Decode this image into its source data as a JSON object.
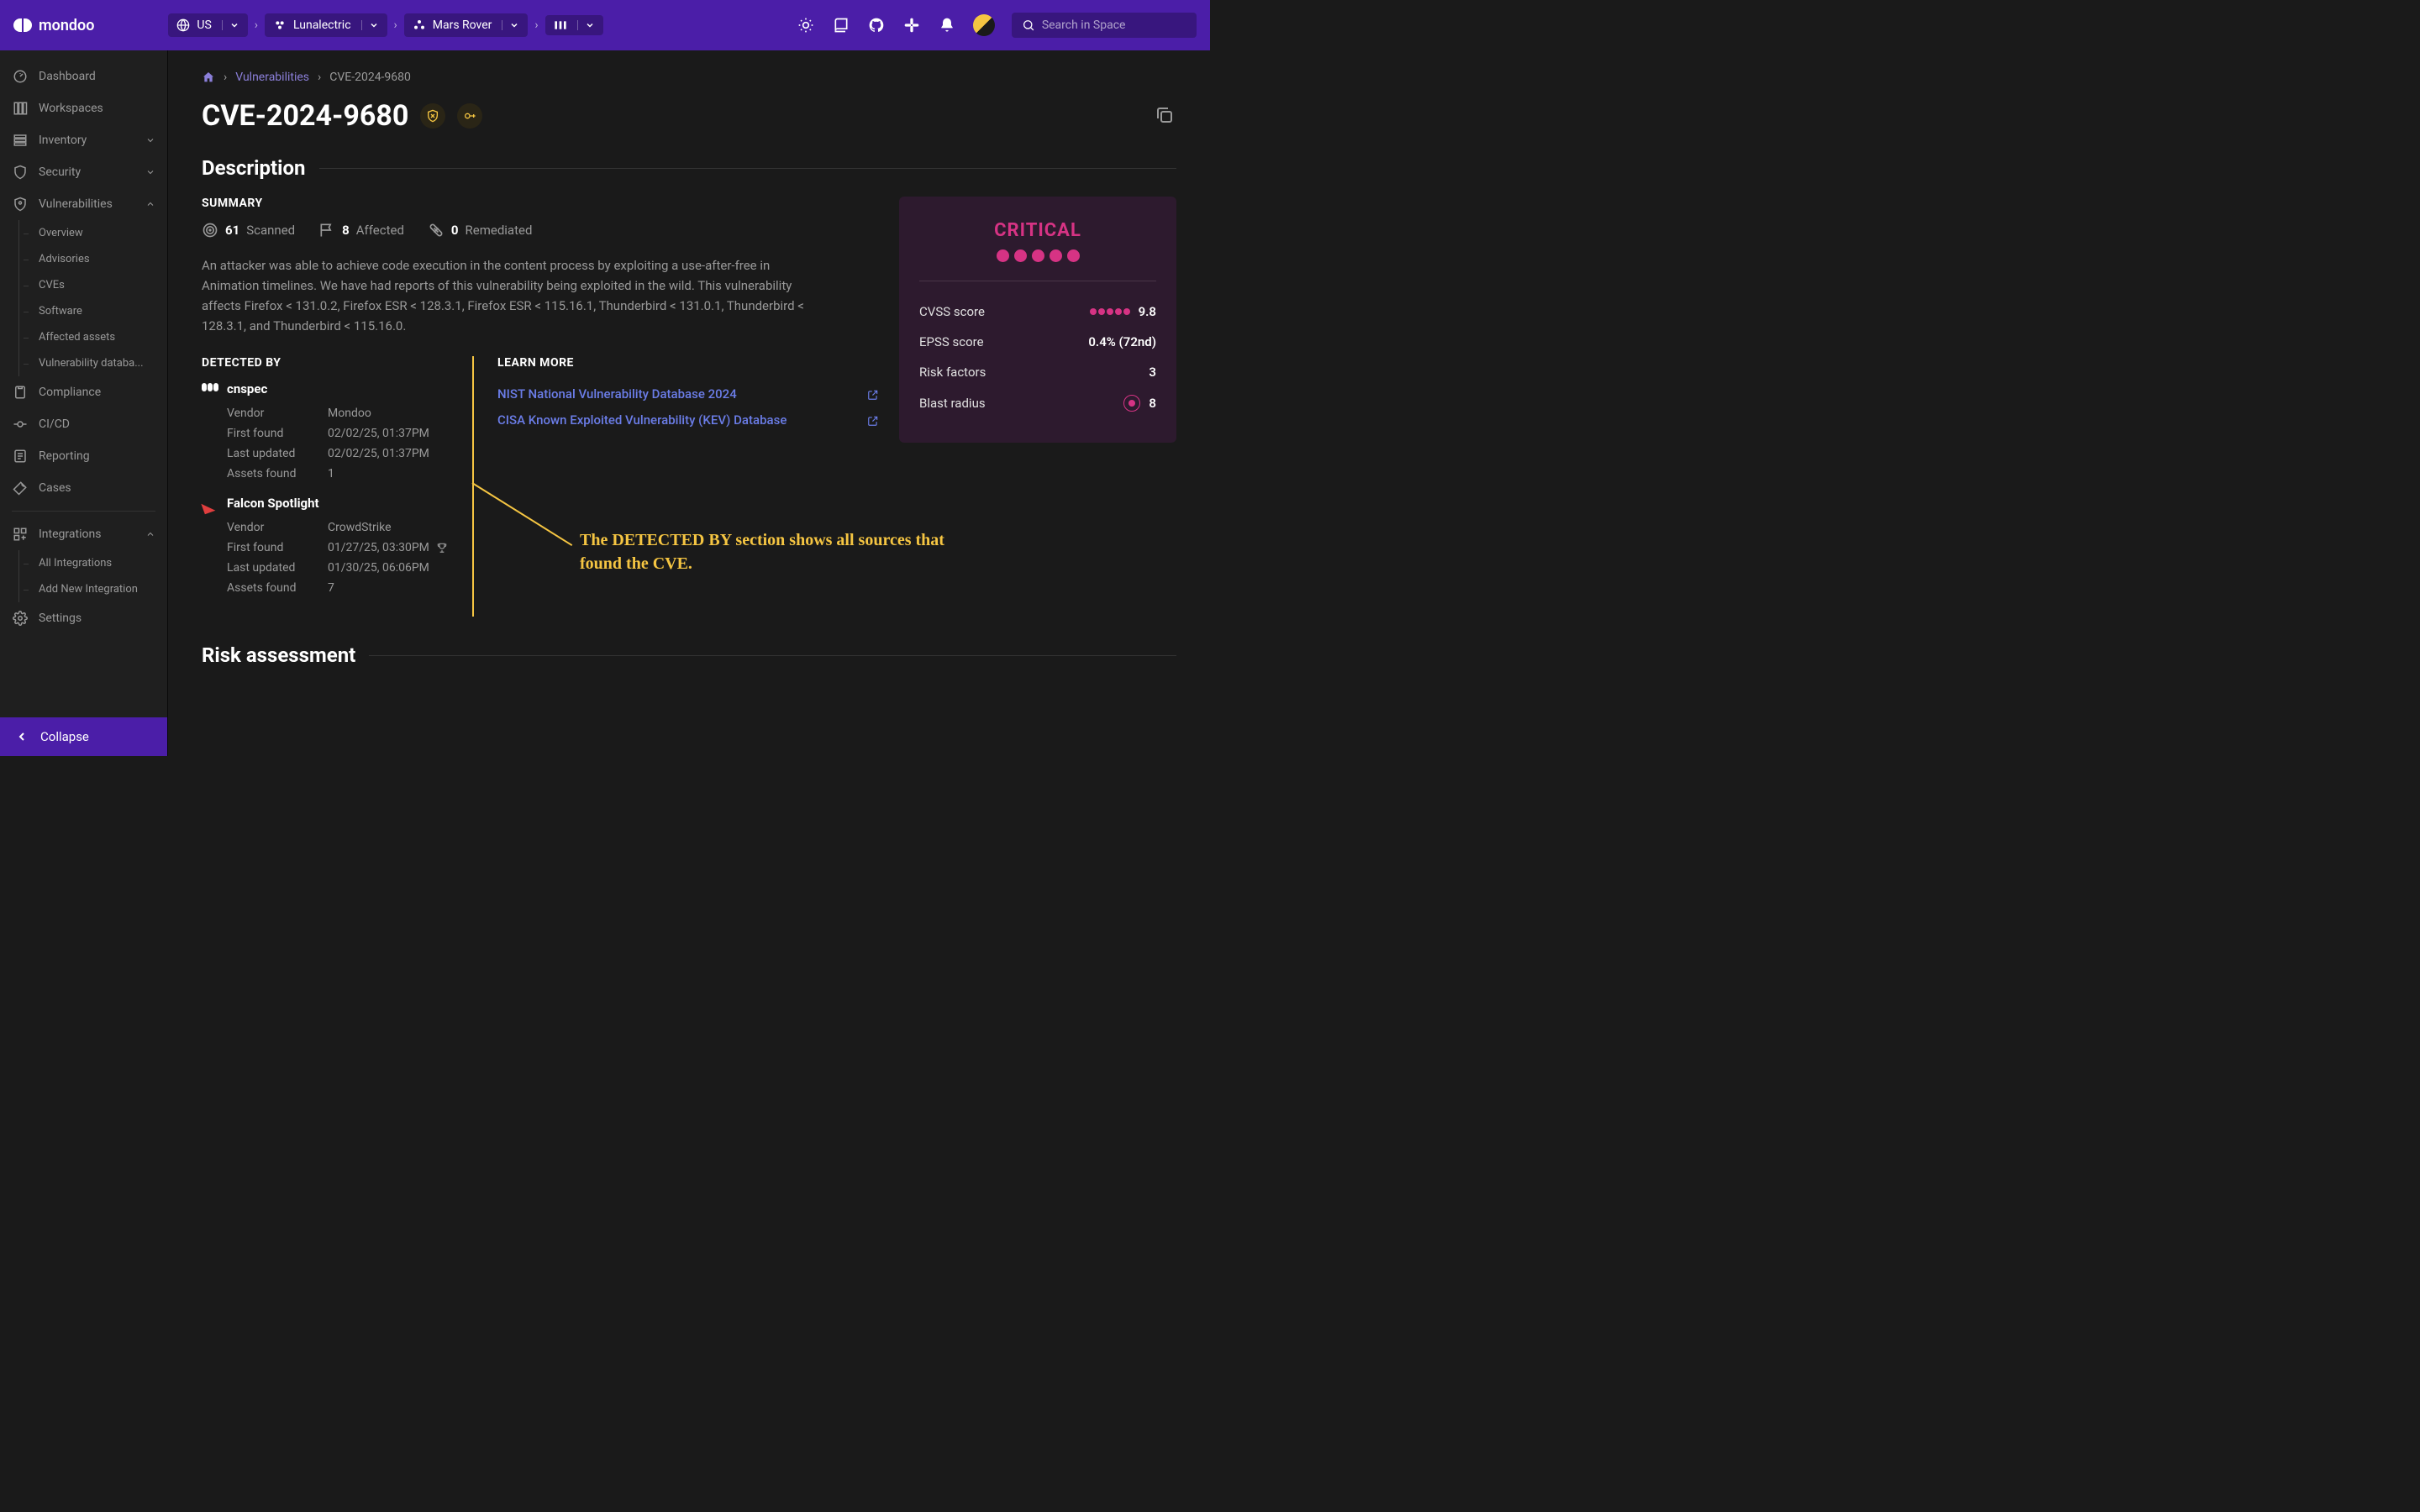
{
  "brand": "mondoo",
  "topbar": {
    "region": "US",
    "org": "Lunalectric",
    "space": "Mars Rover",
    "search_placeholder": "Search in Space"
  },
  "sidebar": {
    "items": [
      {
        "label": "Dashboard"
      },
      {
        "label": "Workspaces"
      },
      {
        "label": "Inventory",
        "expandable": true
      },
      {
        "label": "Security",
        "expandable": true
      },
      {
        "label": "Vulnerabilities",
        "expanded": true,
        "children": [
          "Overview",
          "Advisories",
          "CVEs",
          "Software",
          "Affected assets",
          "Vulnerability databa..."
        ]
      },
      {
        "label": "Compliance"
      },
      {
        "label": "CI/CD"
      },
      {
        "label": "Reporting"
      },
      {
        "label": "Cases"
      }
    ],
    "integrations": {
      "label": "Integrations",
      "children": [
        "All Integrations",
        "Add New Integration"
      ]
    },
    "settings": "Settings",
    "collapse": "Collapse"
  },
  "breadcrumb": {
    "section": "Vulnerabilities",
    "current": "CVE-2024-9680"
  },
  "page": {
    "title": "CVE-2024-9680",
    "description_heading": "Description",
    "summary_label": "SUMMARY",
    "stats": {
      "scanned_n": "61",
      "scanned_l": "Scanned",
      "affected_n": "8",
      "affected_l": "Affected",
      "remediated_n": "0",
      "remediated_l": "Remediated"
    },
    "summary_text": "An attacker was able to achieve code execution in the content process by exploiting a use-after-free in Animation timelines. We have had reports of this vulnerability being exploited in the wild. This vulnerability affects Firefox < 131.0.2, Firefox ESR < 128.3.1, Firefox ESR < 115.16.1, Thunderbird < 131.0.1, Thunderbird < 128.3.1, and Thunderbird < 115.16.0.",
    "detected_by_label": "DETECTED BY",
    "learn_more_label": "LEARN MORE",
    "detectors": [
      {
        "name": "cnspec",
        "rows": {
          "Vendor": "Mondoo",
          "First found": "02/02/25, 01:37PM",
          "Last updated": "02/02/25, 01:37PM",
          "Assets found": "1"
        }
      },
      {
        "name": "Falcon Spotlight",
        "rows": {
          "Vendor": "CrowdStrike",
          "First found": "01/27/25, 03:30PM",
          "Last updated": "01/30/25, 06:06PM",
          "Assets found": "7"
        },
        "trophy": true
      }
    ],
    "learn_links": [
      "NIST National Vulnerability Database 2024",
      "CISA Known Exploited Vulnerability (KEV) Database"
    ],
    "risk_assessment_heading": "Risk assessment"
  },
  "risk": {
    "level": "CRITICAL",
    "cvss_label": "CVSS score",
    "cvss_value": "9.8",
    "epss_label": "EPSS score",
    "epss_value": "0.4% (72nd)",
    "factors_label": "Risk factors",
    "factors_value": "3",
    "blast_label": "Blast radius",
    "blast_value": "8"
  },
  "annotation": "The DETECTED BY section shows all sources that found the CVE."
}
